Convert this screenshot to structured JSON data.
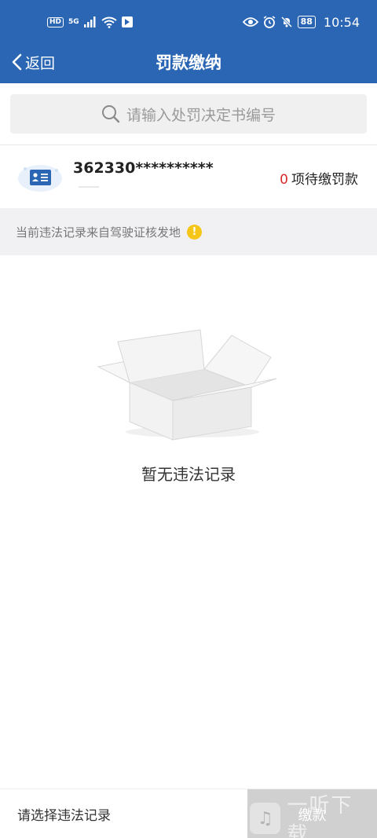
{
  "status_bar": {
    "hd_badge": "HD",
    "network": "5G",
    "battery": "88",
    "time": "10:54"
  },
  "nav": {
    "back_label": "返回",
    "title": "罚款缴纳"
  },
  "search": {
    "placeholder": "请输入处罚决定书编号"
  },
  "license": {
    "number": "362330**********",
    "pending_count": "0",
    "pending_label": "项待缴罚款"
  },
  "notice": {
    "text": "当前违法记录来自驾驶证核发地",
    "badge": "!"
  },
  "empty_state": {
    "text": "暂无违法记录"
  },
  "footer": {
    "select_hint": "请选择违法记录",
    "pay_label": "缴款"
  },
  "watermark": {
    "text": "一听下载"
  },
  "colors": {
    "primary": "#2a66b3",
    "pending_count": "#d72b2b",
    "notice_badge": "#f5c518",
    "disabled_button": "#d0d0d0"
  }
}
